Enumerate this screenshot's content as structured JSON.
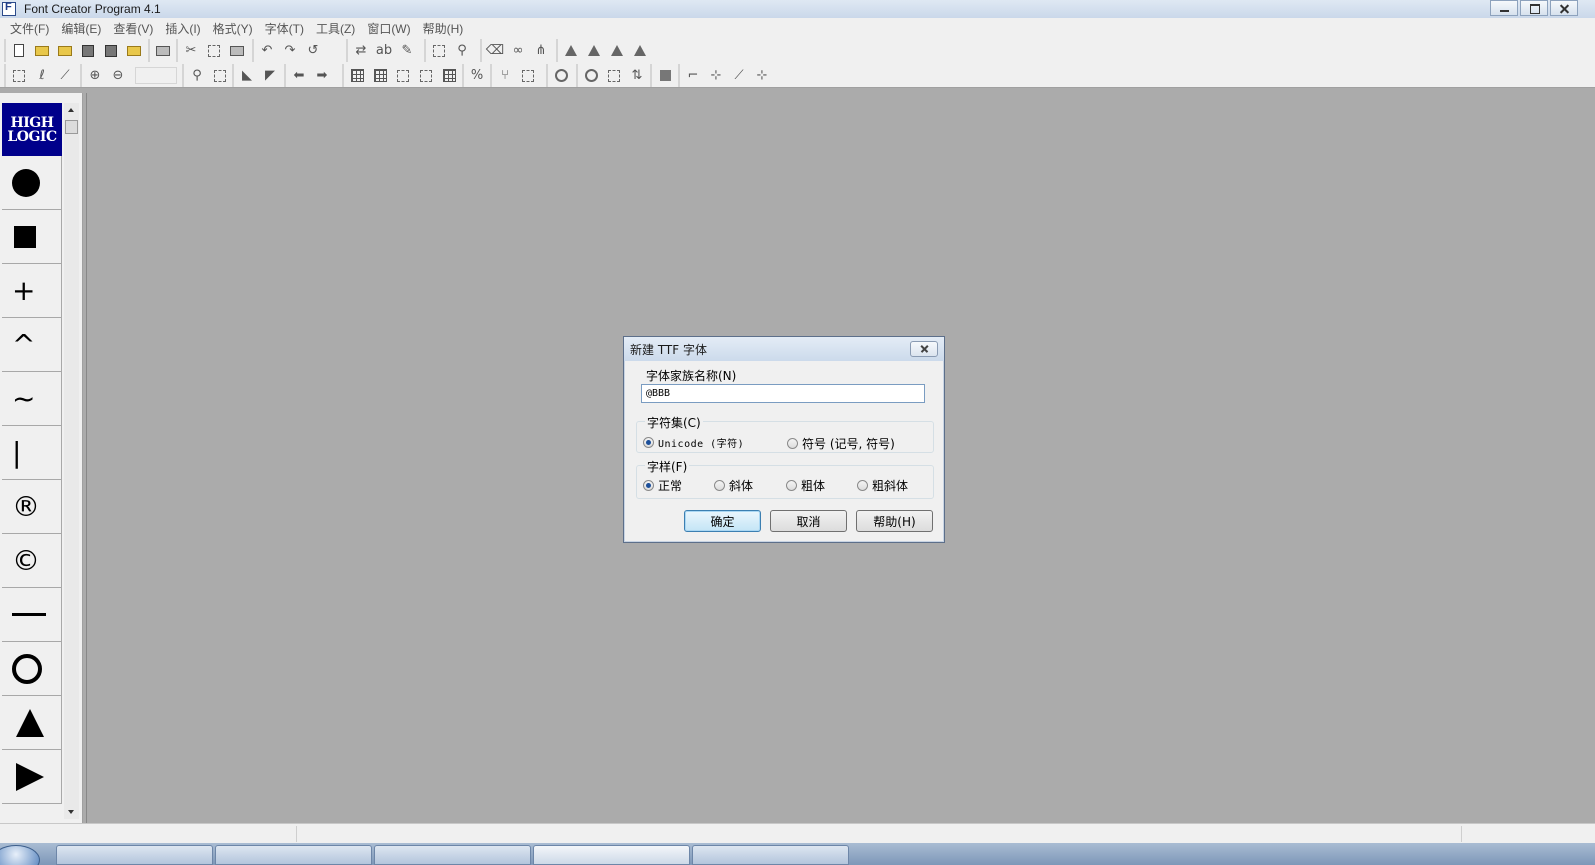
{
  "window": {
    "title": "Font Creator Program 4.1"
  },
  "menu": {
    "items": [
      "文件(F)",
      "编辑(E)",
      "查看(V)",
      "插入(I)",
      "格式(Y)",
      "字体(T)",
      "工具(Z)",
      "窗口(W)",
      "帮助(H)"
    ]
  },
  "palette": {
    "logo_line1": "HIGH",
    "logo_line2": "LOGIC",
    "glyphs": {
      "plus": "+",
      "caret": "^",
      "tilde": "~",
      "bar": "|",
      "registered": "®",
      "copyright": "©"
    }
  },
  "dialog": {
    "title": "新建 TTF 字体",
    "family_label": "字体家族名称(N)",
    "family_value": "@BBB",
    "charset_label": "字符集(C)",
    "charset_options": [
      "Unicode (字符)",
      "符号 (记号, 符号)"
    ],
    "charset_selected": "Unicode (字符)",
    "style_label": "字样(F)",
    "style_options": [
      "正常",
      "斜体",
      "粗体",
      "粗斜体"
    ],
    "style_selected": "正常",
    "ok_label": "确定",
    "cancel_label": "取消",
    "help_label": "帮助(H)"
  }
}
